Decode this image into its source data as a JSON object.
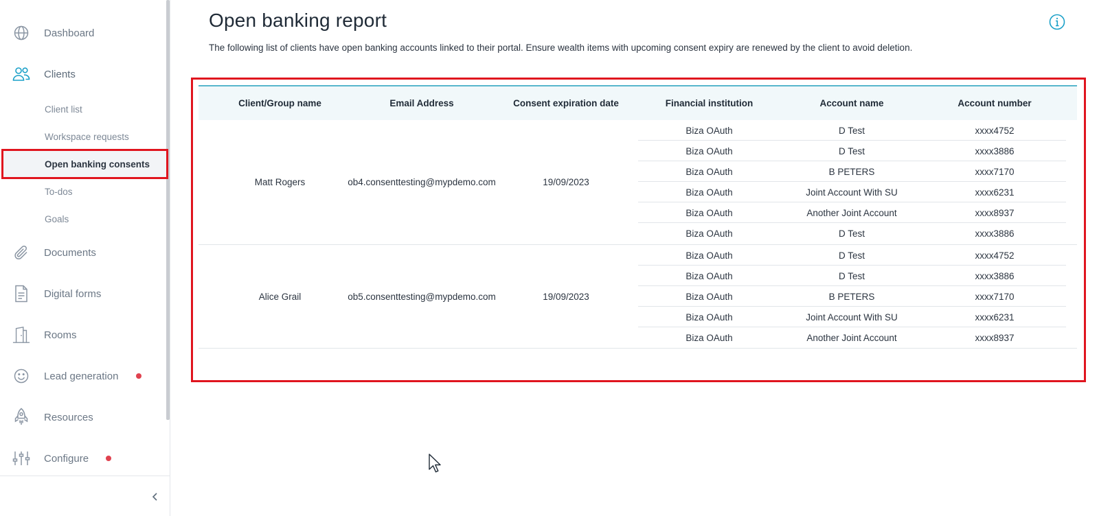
{
  "sidebar": {
    "nav": [
      {
        "label": "Dashboard",
        "icon": "globe-icon"
      },
      {
        "label": "Clients",
        "icon": "users-icon"
      },
      {
        "label": "Documents",
        "icon": "paperclip-icon"
      },
      {
        "label": "Digital forms",
        "icon": "form-icon"
      },
      {
        "label": "Rooms",
        "icon": "building-icon"
      },
      {
        "label": "Lead generation",
        "icon": "smiley-icon",
        "badge": true
      },
      {
        "label": "Resources",
        "icon": "rocket-icon"
      },
      {
        "label": "Configure",
        "icon": "sliders-icon",
        "badge": true
      }
    ],
    "clients_sub": [
      {
        "label": "Client list"
      },
      {
        "label": "Workspace requests"
      },
      {
        "label": "Open banking consents",
        "selected": true
      },
      {
        "label": "To-dos"
      },
      {
        "label": "Goals"
      }
    ],
    "collapse_icon": "chevron-left-icon"
  },
  "page": {
    "title": "Open banking report",
    "description": "The following list of clients have open banking accounts linked to their portal. Ensure wealth items with upcoming consent expiry are renewed by the client to avoid deletion.",
    "info_icon": "info-icon"
  },
  "table": {
    "headers": [
      "Client/Group name",
      "Email Address",
      "Consent expiration date",
      "Financial institution",
      "Account name",
      "Account number"
    ],
    "groups": [
      {
        "name": "Matt Rogers",
        "email": "ob4.consenttesting@mypdemo.com",
        "expiry": "19/09/2023",
        "accounts": [
          {
            "institution": "Biza OAuth",
            "name": "D Test",
            "number": "xxxx4752"
          },
          {
            "institution": "Biza OAuth",
            "name": "D Test",
            "number": "xxxx3886"
          },
          {
            "institution": "Biza OAuth",
            "name": "B PETERS",
            "number": "xxxx7170"
          },
          {
            "institution": "Biza OAuth",
            "name": "Joint Account With SU",
            "number": "xxxx6231"
          },
          {
            "institution": "Biza OAuth",
            "name": "Another Joint Account",
            "number": "xxxx8937"
          },
          {
            "institution": "Biza OAuth",
            "name": "D Test",
            "number": "xxxx3886"
          }
        ]
      },
      {
        "name": "Alice Grail",
        "email": "ob5.consenttesting@mypdemo.com",
        "expiry": "19/09/2023",
        "accounts": [
          {
            "institution": "Biza OAuth",
            "name": "D Test",
            "number": "xxxx4752"
          },
          {
            "institution": "Biza OAuth",
            "name": "D Test",
            "number": "xxxx3886"
          },
          {
            "institution": "Biza OAuth",
            "name": "B PETERS",
            "number": "xxxx7170"
          },
          {
            "institution": "Biza OAuth",
            "name": "Joint Account With SU",
            "number": "xxxx6231"
          },
          {
            "institution": "Biza OAuth",
            "name": "Another Joint Account",
            "number": "xxxx8937"
          }
        ]
      }
    ]
  },
  "colors": {
    "accent": "#1aa0c8",
    "highlight": "#e0141e",
    "badge": "#e0424f",
    "header_bg": "#f1f8fa"
  }
}
